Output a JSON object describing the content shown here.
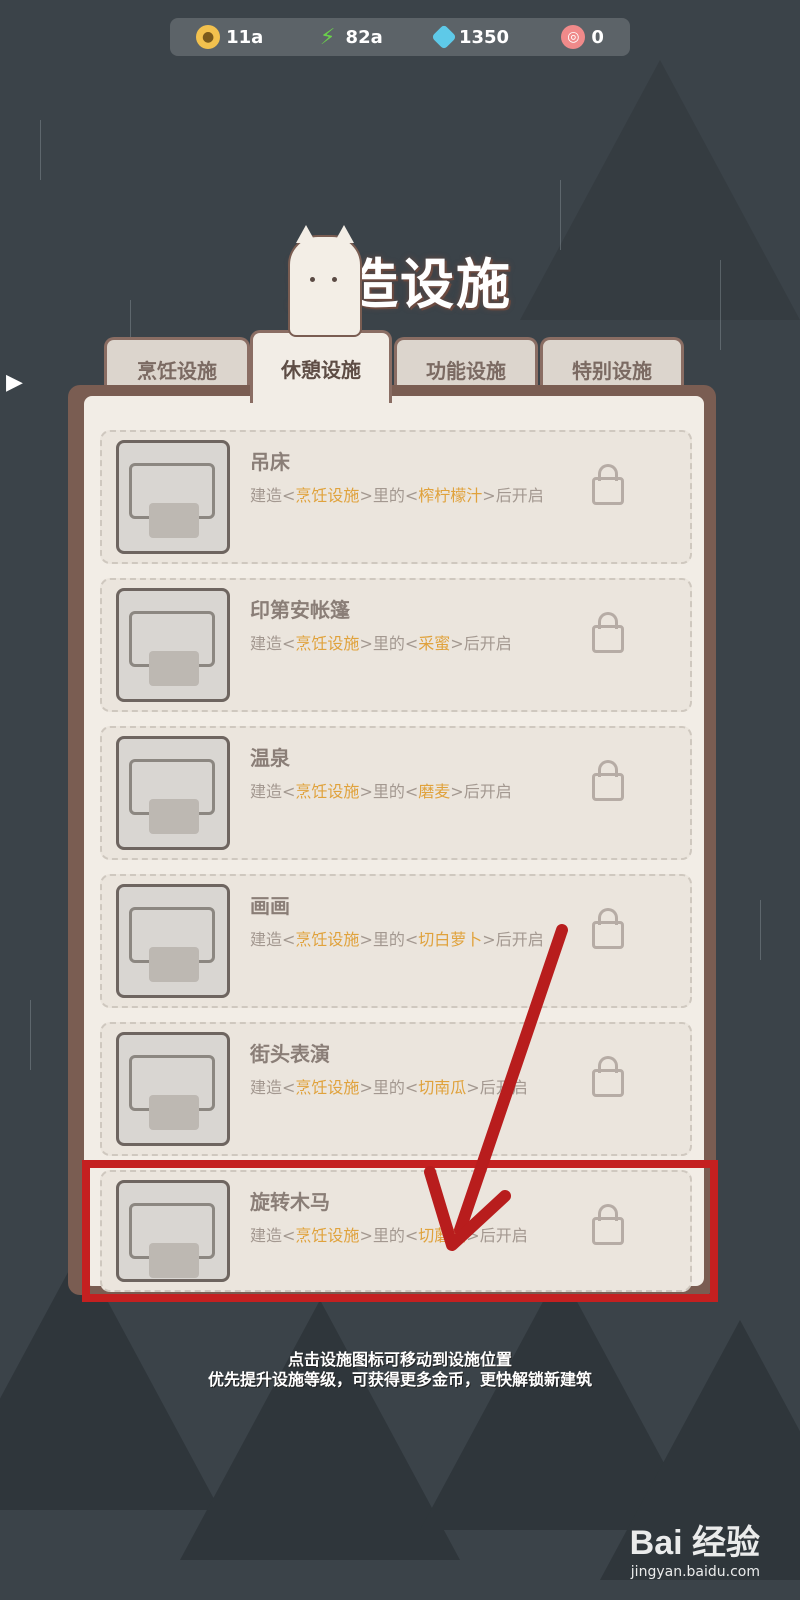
{
  "resources": [
    {
      "icon": "coin-icon",
      "value": "11a",
      "color": "#f2c14e"
    },
    {
      "icon": "lightning-icon",
      "value": "82a",
      "color": "#6ad04b"
    },
    {
      "icon": "diamond-icon",
      "value": "1350",
      "color": "#5ec9e8"
    },
    {
      "icon": "donut-icon",
      "value": "0",
      "color": "#f08a8a"
    }
  ],
  "title": "建造设施",
  "tabs": [
    {
      "label": "烹饪设施",
      "active": false
    },
    {
      "label": "休憩设施",
      "active": true
    },
    {
      "label": "功能设施",
      "active": false
    },
    {
      "label": "特别设施",
      "active": false
    }
  ],
  "facilities": [
    {
      "name": "吊床",
      "req_prefix": "建造<",
      "req_cat": "烹饪设施",
      "req_mid": ">里的<",
      "req_item": "榨柠檬汁",
      "req_suffix": ">后开启",
      "locked": true
    },
    {
      "name": "印第安帐篷",
      "req_prefix": "建造<",
      "req_cat": "烹饪设施",
      "req_mid": ">里的<",
      "req_item": "采蜜",
      "req_suffix": ">后开启",
      "locked": true
    },
    {
      "name": "温泉",
      "req_prefix": "建造<",
      "req_cat": "烹饪设施",
      "req_mid": ">里的<",
      "req_item": "磨麦",
      "req_suffix": ">后开启",
      "locked": true
    },
    {
      "name": "画画",
      "req_prefix": "建造<",
      "req_cat": "烹饪设施",
      "req_mid": ">里的<",
      "req_item": "切白萝卜",
      "req_suffix": ">后开启",
      "locked": true
    },
    {
      "name": "街头表演",
      "req_prefix": "建造<",
      "req_cat": "烹饪设施",
      "req_mid": ">里的<",
      "req_item": "切南瓜",
      "req_suffix": ">后开启",
      "locked": true
    },
    {
      "name": "旋转木马",
      "req_prefix": "建造<",
      "req_cat": "烹饪设施",
      "req_mid": ">里的<",
      "req_item": "切蘑菇",
      "req_suffix": ">后开启",
      "locked": true
    }
  ],
  "hints": {
    "line1": "点击设施图标可移动到设施位置",
    "line2": "优先提升设施等级，可获得更多金币，更快解锁新建筑"
  },
  "watermark": {
    "logo": "Bai 经验",
    "url": "jingyan.baidu.com"
  }
}
